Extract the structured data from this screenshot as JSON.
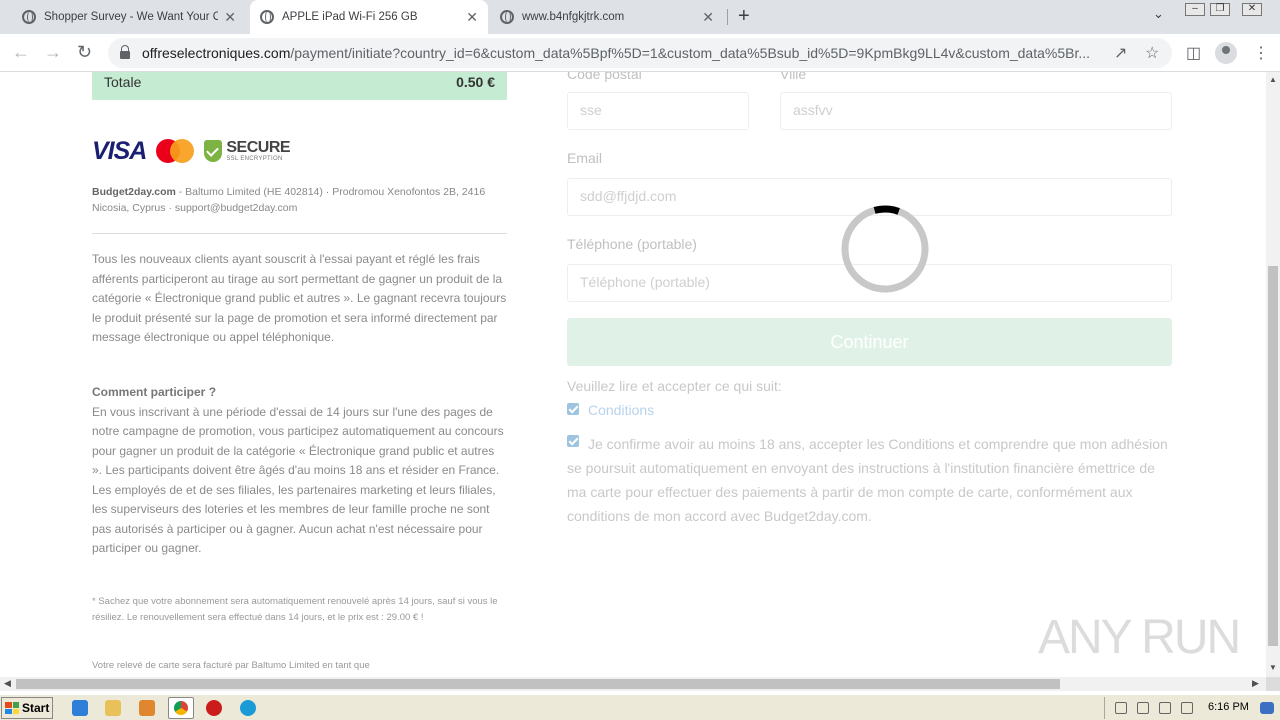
{
  "browser": {
    "tabs": [
      {
        "title": "Shopper Survey - We Want Your Op",
        "active": false
      },
      {
        "title": "APPLE iPad Wi-Fi 256 GB",
        "active": true
      },
      {
        "title": "www.b4nfgkjtrk.com",
        "active": false
      }
    ],
    "url_host": "offreselectroniques.com",
    "url_path": "/payment/initiate?country_id=6&custom_data%5Bpf%5D=1&custom_data%5Bsub_id%5D=9KpmBkg9LL4v&custom_data%5Br..."
  },
  "summary": {
    "total_label": "Totale",
    "total_value": "0.50 €"
  },
  "logos": {
    "visa": "VISA",
    "secure": "SECURE",
    "secure_sub": "SSL ENCRYPTION"
  },
  "company": {
    "name": "Budget2day.com",
    "details": " - Baltumo Limited (HE 402814) · Prodromou Xenofontos 2B, 2416 Nicosia, Cyprus · support@budget2day.com"
  },
  "info": {
    "para1": "Tous les nouveaux clients ayant souscrit à l'essai payant et réglé les frais afférents participeront au tirage au sort permettant de gagner un produit de la catégorie « Électronique grand public et autres ». Le gagnant recevra toujours le produit présenté sur la page de promotion et sera informé directement par message électronique ou appel téléphonique.",
    "heading": "Comment participer ?",
    "para2": "En vous inscrivant à une période d'essai de 14 jours sur l'une des pages de notre campagne de promotion, vous participez automatiquement au concours pour gagner un produit de la catégorie « Électronique grand public et autres ». Les participants doivent être âgés d'au moins 18 ans et résider en France. Les employés de et de ses filiales, les partenaires marketing et leurs filiales, les superviseurs des loteries et les membres de leur famille proche ne sont pas autorisés à participer ou à gagner. Aucun achat n'est nécessaire pour participer ou gagner.",
    "note": "* Sachez que votre abonnement sera automatiquement renouvelé après 14 jours, sauf si vous le résiliez. Le renouvellement sera effectué dans 14 jours, et le prix est : 29.00 € !",
    "billing": "Votre relevé de carte sera facturé par Baltumo Limited en tant que"
  },
  "form": {
    "postal_label": "Code postal",
    "postal_value": "sse",
    "city_label": "Ville",
    "city_value": "assfvv",
    "email_label": "Email",
    "email_value": "sdd@ffjdjd.com",
    "phone_label": "Téléphone (portable)",
    "phone_placeholder": "Téléphone (portable)",
    "submit_label": "Continuer",
    "ack_text": "Veuillez lire et accepter ce qui suit:",
    "conditions_link": "Conditions",
    "confirm_text": "Je confirme avoir au moins 18 ans, accepter les Conditions et comprendre que mon adhésion se poursuit automatiquement en envoyant des instructions à l'institution financière émettrice de ma carte pour effectuer des paiements à partir de mon compte de carte, conformément aux conditions de mon accord avec Budget2day.com."
  },
  "watermark": "ANY RUN",
  "taskbar": {
    "start_label": "Start",
    "clock": "6:16 PM"
  }
}
